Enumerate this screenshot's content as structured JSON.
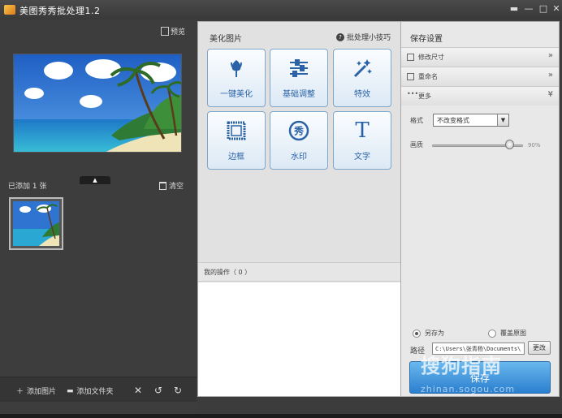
{
  "window": {
    "title": "美图秀秀批处理1.2",
    "controls": [
      "▬",
      "—",
      "□",
      "✕"
    ]
  },
  "left_panel": {
    "preview_label": "预览",
    "added_label": "已添加 1 张",
    "clear_label": "清空",
    "add_image_label": "添加图片",
    "add_folder_label": "添加文件夹"
  },
  "middle_panel": {
    "title": "美化图片",
    "tip_label": "批处理小技巧",
    "tools": [
      {
        "label": "一键美化",
        "icon": "tulip-icon"
      },
      {
        "label": "基础调整",
        "icon": "sliders-icon"
      },
      {
        "label": "特效",
        "icon": "magic-wand-icon"
      },
      {
        "label": "边框",
        "icon": "frame-icon"
      },
      {
        "label": "水印",
        "icon": "watermark-icon",
        "glyph": "秀"
      },
      {
        "label": "文字",
        "icon": "text-icon",
        "glyph": "T"
      }
    ],
    "ops_label": "我的操作（ 0 ）"
  },
  "right_panel": {
    "title": "保存设置",
    "rows": [
      {
        "label": "修改尺寸",
        "icon": "crop-icon",
        "chevron": "»"
      },
      {
        "label": "重命名",
        "icon": "rename-icon",
        "chevron": "»"
      },
      {
        "label": "更多",
        "icon": "more-icon",
        "chevron": "¥"
      }
    ],
    "format_label": "格式",
    "format_value": "不改变格式",
    "quality_label": "画质",
    "quality_value": "90%",
    "save_as_label": "另存为",
    "overwrite_label": "覆盖原图",
    "path_label": "路径",
    "path_value": "C:\\Users\\张青杨\\Documents\\",
    "change_label": "更改",
    "save_label": "保存"
  },
  "watermark": {
    "text": "搜狗指南",
    "url": "zhinan.sogou.com"
  },
  "colors": {
    "dark_panel": "#3d3d3d",
    "accent_blue": "#2a7fcf",
    "tool_label": "#2a62a8"
  }
}
